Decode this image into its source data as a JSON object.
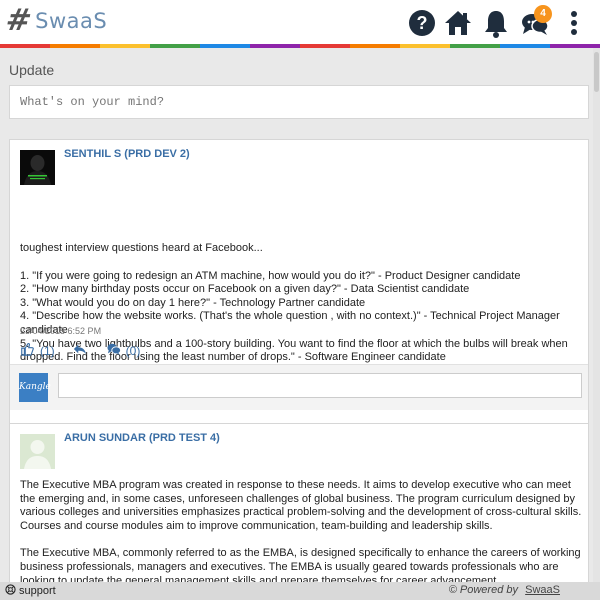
{
  "app": {
    "logo_symbol": "#",
    "logo_text": "SwaaS",
    "notification_count": "4"
  },
  "topbar": {
    "icons": [
      "help-icon",
      "home-icon",
      "bell-icon",
      "chat-icon",
      "more-vertical-icon"
    ]
  },
  "colors": {
    "strip": [
      "#e53935",
      "#f57c00",
      "#fbc02d",
      "#43a047",
      "#1e88e5",
      "#8e24aa",
      "#e53935",
      "#f57c00",
      "#fbc02d",
      "#43a047",
      "#1e88e5",
      "#8e24aa"
    ],
    "badge": "#f7941d",
    "link": "#3a6ea5"
  },
  "update": {
    "title": "Update",
    "placeholder": "What's on your mind?"
  },
  "posts": [
    {
      "author": "SENTHIL S (PRD DEV 2)",
      "intro": "toughest interview questions heard at Facebook...",
      "lines": [
        "1. \"If you were going to redesign an ATM machine, how would you do it?\" - Product Designer candidate",
        "2. \"How many birthday posts occur on Facebook on a given day?\" - Data Scientist candidate",
        "3. \"What would you do on day 1 here?\" - Technology Partner candidate",
        "4. \"Describe how the website works. (That's the whole question , with no context.)\" - Technical Project Manager candidate",
        "5. \"You have two lightbulbs and a 100-story building. You want to find the floor at which the bulbs will break when dropped. Find the floor using the least number of drops.\" - Software Engineer candidate"
      ],
      "timestamp": "23/04/2015 6:52 PM",
      "likes": "(1)",
      "comments": "(0)",
      "commenter_avatar_text": "Kangle"
    },
    {
      "author": "ARUN SUNDAR (PRD TEST 4)",
      "paragraphs": [
        "The Executive MBA program was created in response to these needs. It aims to develop executive who can meet the emerging and, in some cases, unforeseen challenges of global business. The program curriculum designed by various colleges and universities emphasizes practical problem-solving and the development of cross-cultural skills. Courses and course modules aim to improve communication, team-building and leadership skills.",
        "The Executive MBA, commonly referred to as the EMBA, is designed specifically to enhance the careers of working business professionals, managers and executives. The EMBA is usually geared towards professionals who are looking to update the general management skills and prepare themselves for career advancement."
      ]
    }
  ],
  "footer": {
    "support": "support",
    "powered_by": "© Powered by",
    "brand": "SwaaS"
  }
}
